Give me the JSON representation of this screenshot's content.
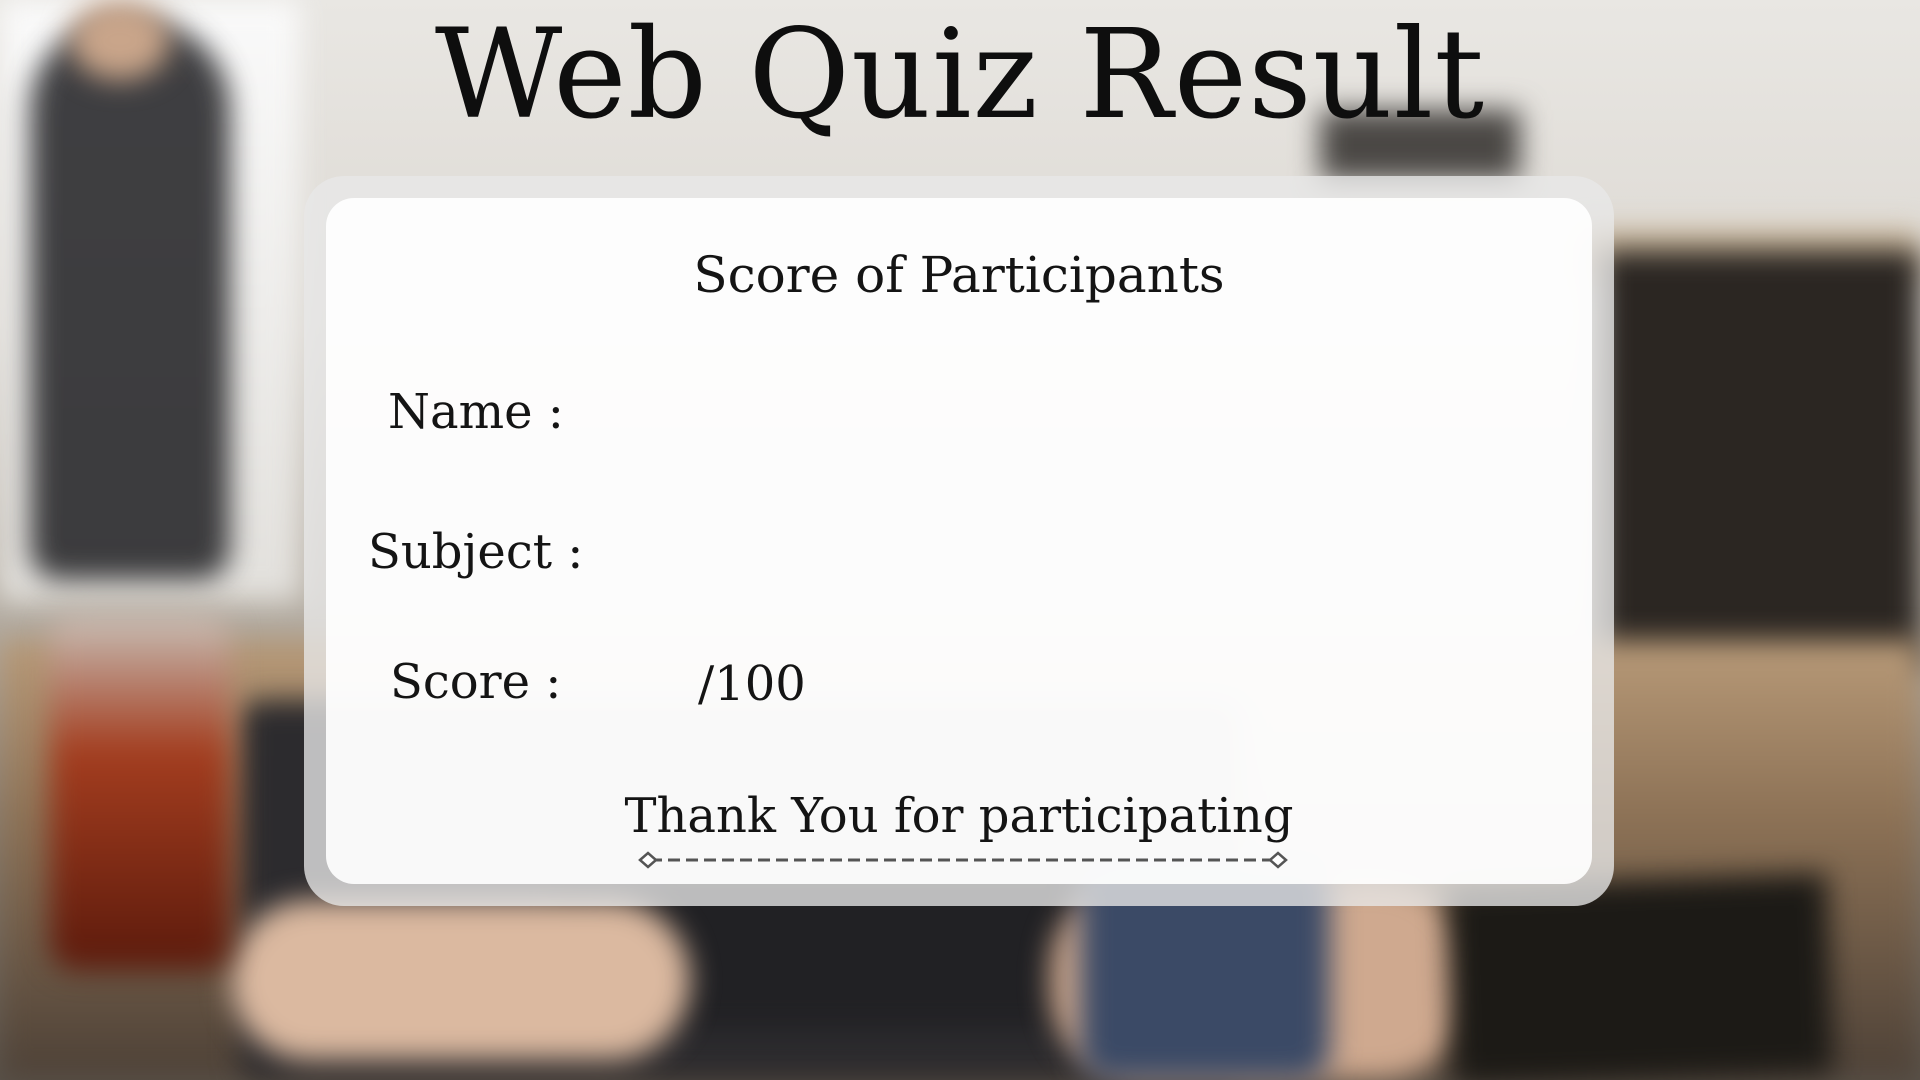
{
  "page": {
    "title": "Web Quiz Result"
  },
  "card": {
    "heading": "Score of Participants",
    "fields": {
      "name_label": "Name :",
      "name_value": "",
      "subject_label": "Subject :",
      "subject_value": "",
      "score_label": "Score :",
      "score_value": "",
      "score_max": "/100"
    },
    "thanks": "Thank You for participating"
  },
  "colors": {
    "text": "#141414",
    "card": "#ffffff",
    "card_frame": "#e8e8e8"
  },
  "icons": {
    "divider": "dashed-line-with-diamond-ends"
  }
}
